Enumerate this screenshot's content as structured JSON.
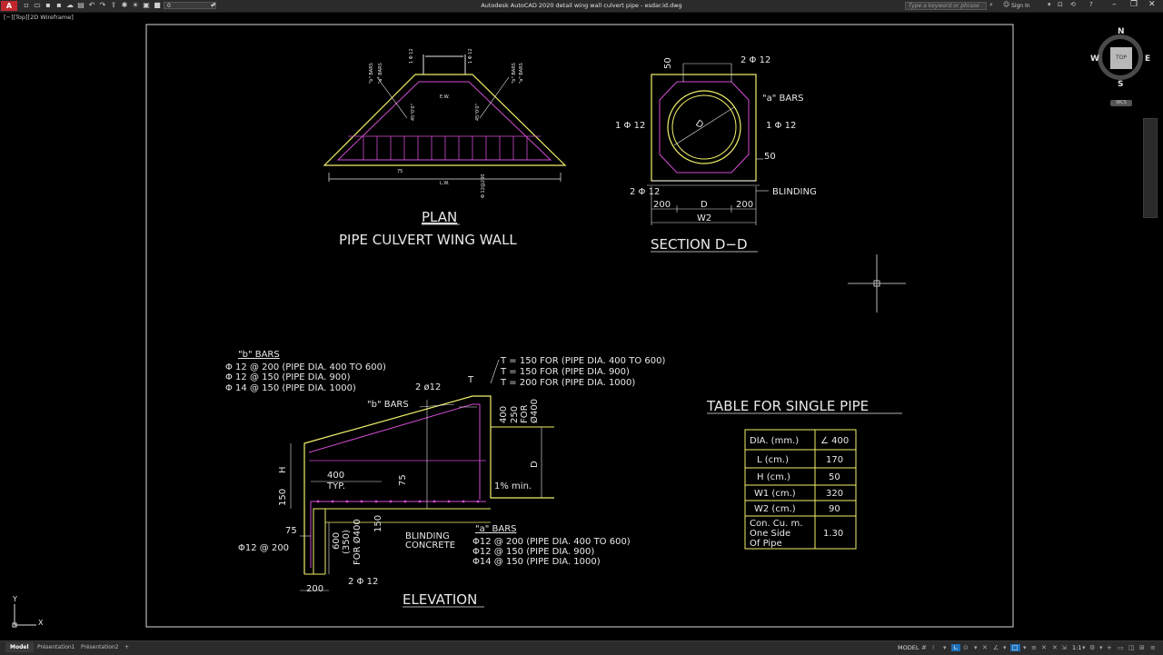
{
  "titlebar": {
    "app_logo": "A",
    "layer_value": "0",
    "title": "Autodesk AutoCAD 2020    detail wing wall culvert pipe - esdar.id.dwg",
    "search_placeholder": "Type a keyword or phrase",
    "sign_in": "Sign In",
    "help": "?"
  },
  "viewport_label": "[−][Top][2D Wireframe]",
  "viewcube": {
    "n": "N",
    "s": "S",
    "e": "E",
    "w": "W",
    "top": "TOP",
    "wcs": "WCS"
  },
  "ucs": {
    "x": "X",
    "y": "Y"
  },
  "plan": {
    "title": "PLAN",
    "subtitle": "PIPE CULVERT WING WALL",
    "labels": [
      "\"b\" BARS",
      "\"a\" BARS",
      "\"b\" BARS",
      "\"a\" BARS",
      "L.W.",
      "45°0'0\"",
      "45°0'0\"",
      "75",
      "E.W.",
      "1 Φ 12",
      "1 Φ 12",
      "Φ 12@200"
    ]
  },
  "section": {
    "title": "SECTION D−D",
    "dim_50_top": "50",
    "bar_top": "2 Φ 12",
    "a_bars": "\"a\" BARS",
    "left_bar": "1 Φ 12",
    "right_bar": "1 Φ 12",
    "dim_50_right": "50",
    "bottom_bar": "2 Φ 12",
    "blinding": "BLINDING",
    "dim_200_left": "200",
    "dim_d": "D",
    "dim_200_right": "200",
    "dim_w2": "W2",
    "circle_d": "D"
  },
  "elevation": {
    "title": "ELEVATION",
    "b_bars_header": "\"b\" BARS",
    "b_bars": [
      "Φ  12 @ 200   (PIPE DIA. 400 TO 600)",
      "Φ  12 @ 150   (PIPE DIA. 900)",
      "Φ  14 @ 150   (PIPE DIA. 1000)"
    ],
    "t_rows": [
      "T = 150 FOR (PIPE DIA. 400 TO 600)",
      "T = 150 FOR (PIPE DIA. 900)",
      "T = 200 FOR (PIPE DIA. 1000)"
    ],
    "t_label": "T",
    "b_bars_label": "\"b\" BARS",
    "bar_2phi12": "2 ø12",
    "dim_400": "400",
    "dim_250": "250",
    "for_label": "FOR",
    "dim_phi400": "Ø400",
    "d_label": "D",
    "h_label": "H",
    "dim_400_typ": "400",
    "typ": "TYP.",
    "dim_75_mid": "75",
    "slope": "1%  min.",
    "dim_150_left": "150",
    "dim_75_left": "75",
    "dim_600": "600",
    "dim_350": "(350)",
    "for_phi400": "FOR Ø400",
    "dim_150_mid": "150",
    "blinding": "BLINDING",
    "concrete": "CONCRETE",
    "phi12_200": "Φ12 @ 200",
    "bar_bottom": "2 Φ 12",
    "dim_200": "200",
    "a_bars_header": "\"a\" BARS",
    "a_bars": [
      "Φ12 @ 200  (PIPE DIA. 400 TO 600)",
      "Φ12 @ 150  (PIPE DIA. 900)",
      "Φ14 @ 150  (PIPE DIA. 1000)"
    ]
  },
  "table": {
    "title": "TABLE FOR SINGLE PIPE",
    "rows": [
      [
        "DIA. (mm.)",
        "∠ 400"
      ],
      [
        "L  (cm.)",
        "170"
      ],
      [
        "H  (cm.)",
        "50"
      ],
      [
        "W1  (cm.)",
        "320"
      ],
      [
        "W2  (cm.)",
        "90"
      ],
      [
        "Con. Cu. m.",
        "1.30"
      ]
    ],
    "row6_line2": "One Side",
    "row6_line3": "Of Pipe"
  },
  "statusbar": {
    "tabs": [
      "Model",
      "Présentation1",
      "Présentation2"
    ],
    "add_tab": "+",
    "model_label": "MODEL",
    "scale": "1:1"
  },
  "colors": {
    "yellow": "#f2f06a",
    "magenta": "#d24cd2",
    "white": "#e8e8e8",
    "frame": "#d8d8d8"
  }
}
